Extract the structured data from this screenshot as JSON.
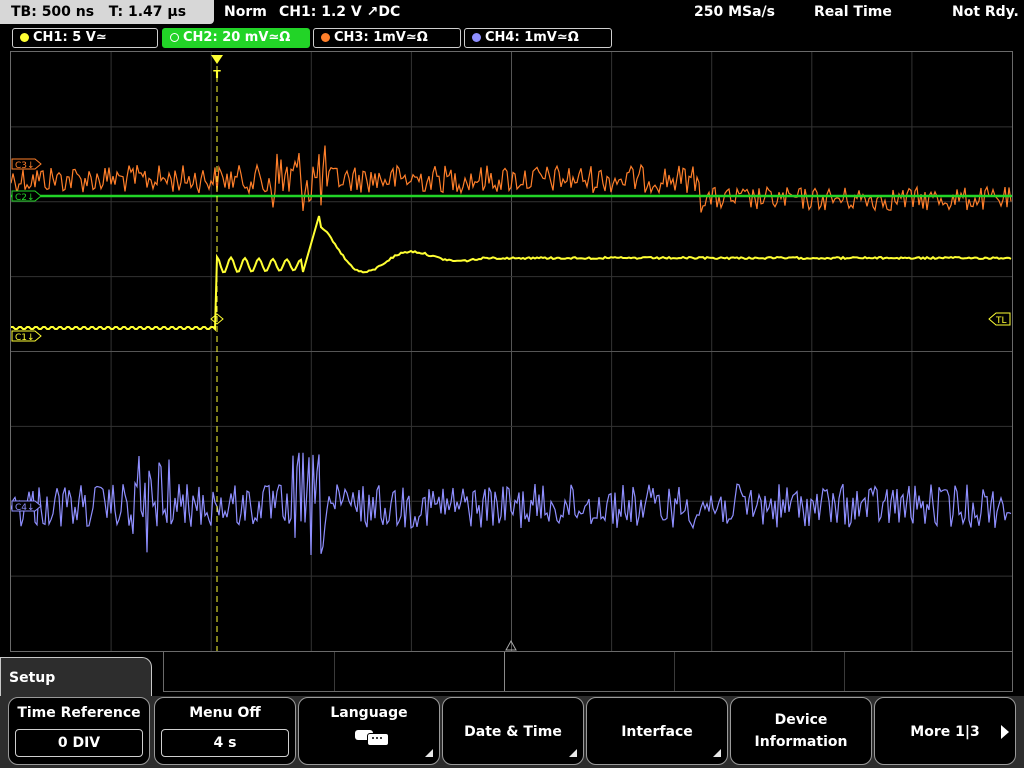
{
  "status": {
    "timebase": "TB: 500 ns",
    "trigger_time": "T: 1.47 µs",
    "mode": "Norm",
    "trigger": "CH1: 1.2 V ↗DC",
    "sample_rate": "250 MSa/s",
    "acq_mode": "Real Time",
    "ready_state": "Not Rdy."
  },
  "channels": [
    {
      "label": "CH1: 5 V≃",
      "color": "#ffff33",
      "active": false
    },
    {
      "label": "CH2: 20 mV≃Ω",
      "color": "#22d427",
      "active": true
    },
    {
      "label": "CH3: 1mV≃Ω",
      "color": "#ff7f2a",
      "active": false
    },
    {
      "label": "CH4: 1mV≃Ω",
      "color": "#8f8fff",
      "active": false
    }
  ],
  "markers": {
    "c3": "C3↓",
    "c2": "C2↓",
    "c1": "C1↓",
    "c4": "C4↓",
    "tl": "TL"
  },
  "menu": {
    "title": "Setup",
    "time_reference": {
      "label": "Time Reference",
      "value": "0 DIV"
    },
    "menu_off": {
      "label": "Menu Off",
      "value": "4 s"
    },
    "language": {
      "label": "Language",
      "icon": "speech-bubbles-icon"
    },
    "date_time": {
      "label": "Date & Time"
    },
    "interface": {
      "label": "Interface"
    },
    "device_info": {
      "line1": "Device",
      "line2": "Information"
    },
    "more": {
      "label": "More 1|3"
    }
  }
}
